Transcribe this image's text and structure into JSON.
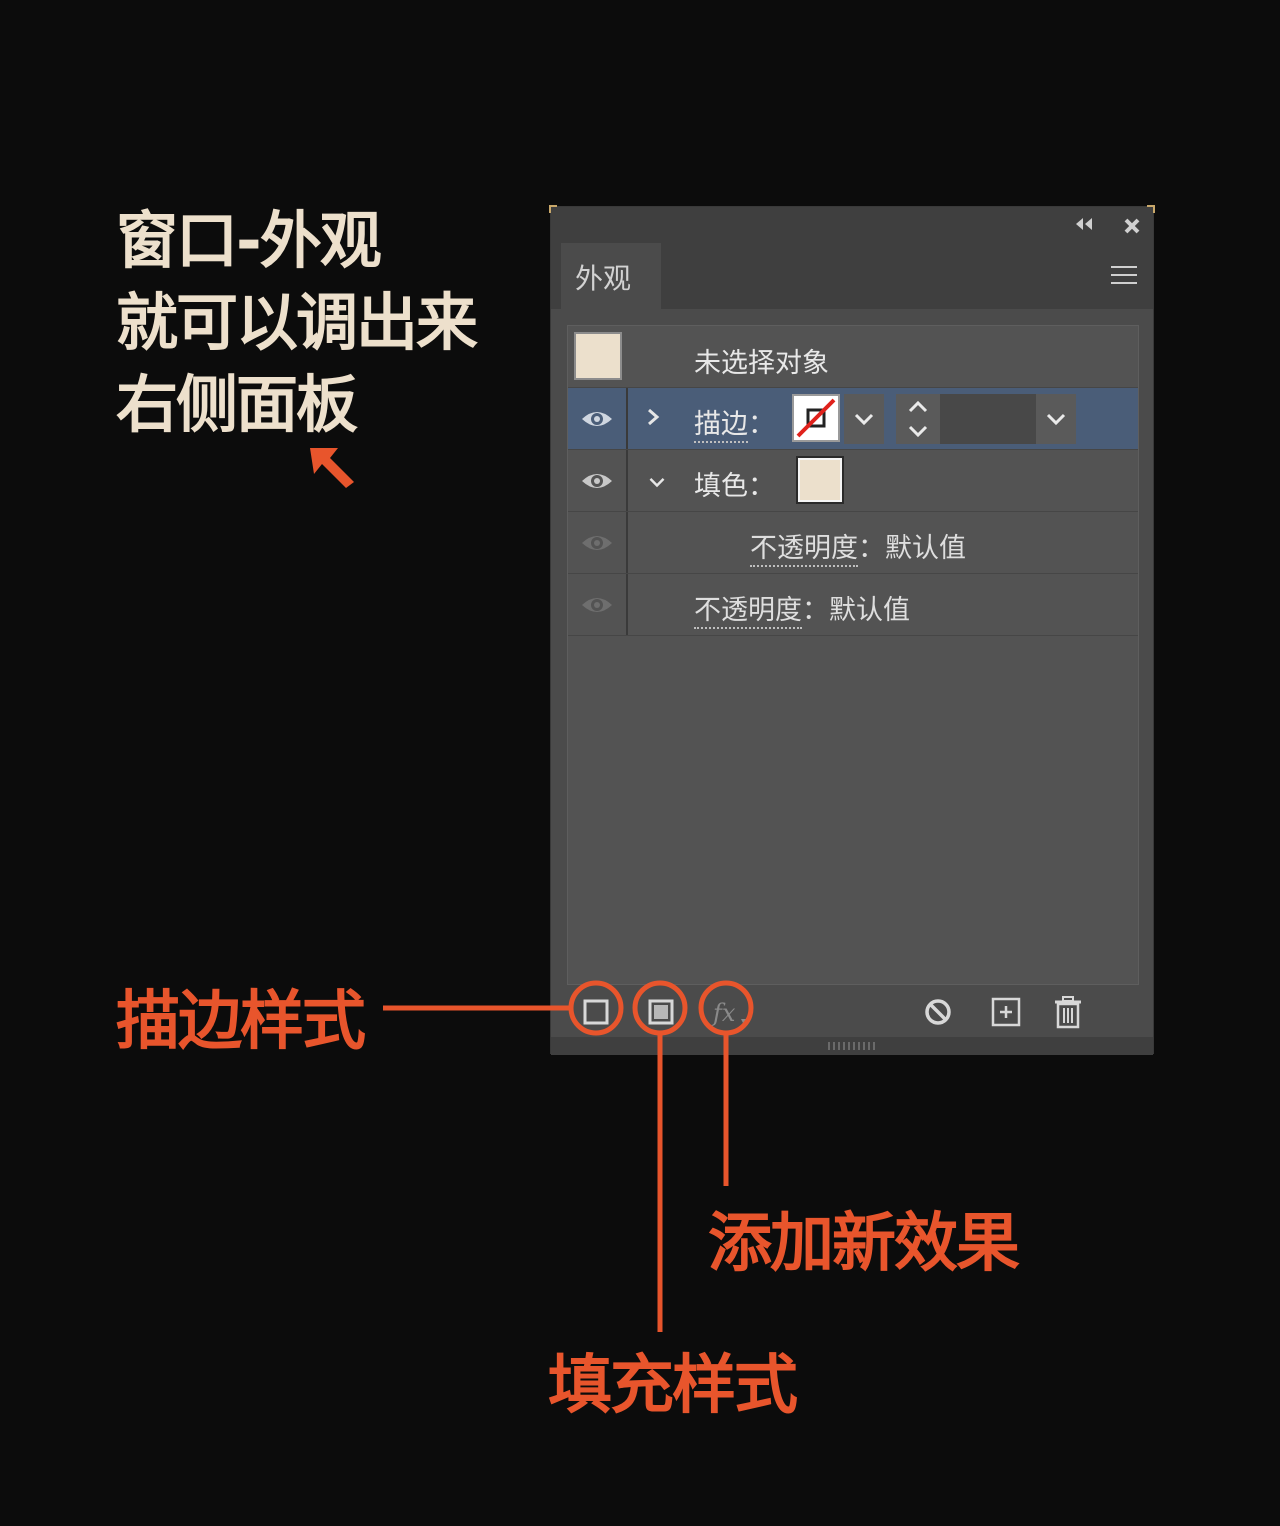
{
  "intro": {
    "lines": [
      "窗口-外观",
      "就可以调出来",
      "右侧面板"
    ]
  },
  "panel": {
    "tab_label": "外观",
    "rows": {
      "object_label": "未选择对象",
      "stroke_label": "描边",
      "stroke_colon": "：",
      "fill_label": "填色",
      "fill_colon": "：",
      "fill_opacity_label": "不透明度",
      "fill_opacity_value": "：默认值",
      "opacity_label": "不透明度",
      "opacity_value": "：默认值"
    },
    "swatch_color": "#ece0cc",
    "selected_row_color": "#4a5d78"
  },
  "callouts": {
    "stroke_style": "描边样式",
    "fill_style": "填充样式",
    "add_effect": "添加新效果",
    "accent_color": "#e8552c"
  },
  "icons": {
    "titlebar": [
      "collapse-icon",
      "close-icon"
    ],
    "tabbar": [
      "panel-menu-icon"
    ],
    "footer": [
      "add-stroke-icon",
      "add-fill-icon",
      "fx-icon",
      "clear-appearance-icon",
      "duplicate-item-icon",
      "delete-item-icon"
    ]
  }
}
